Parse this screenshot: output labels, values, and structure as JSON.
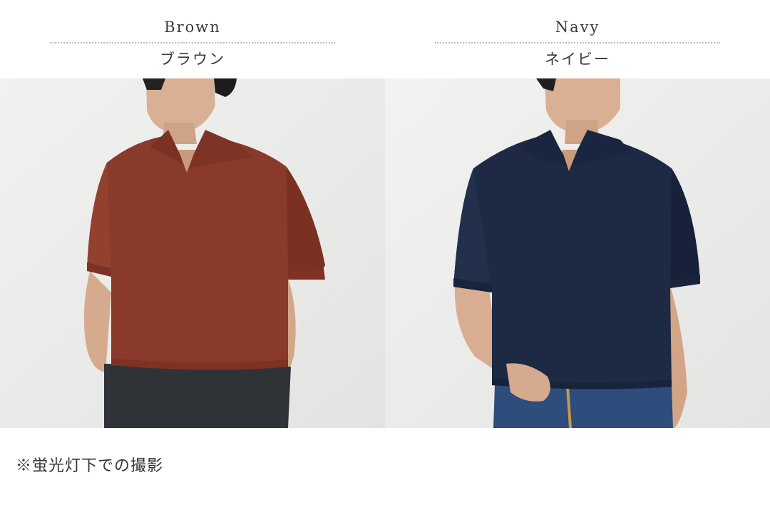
{
  "variants": [
    {
      "name_en": "Brown",
      "name_ja": "ブラウン",
      "color": "#8a3a2a"
    },
    {
      "name_en": "Navy",
      "name_ja": "ネイビー",
      "color": "#1e2a44"
    }
  ],
  "note": "※蛍光灯下での撮影"
}
